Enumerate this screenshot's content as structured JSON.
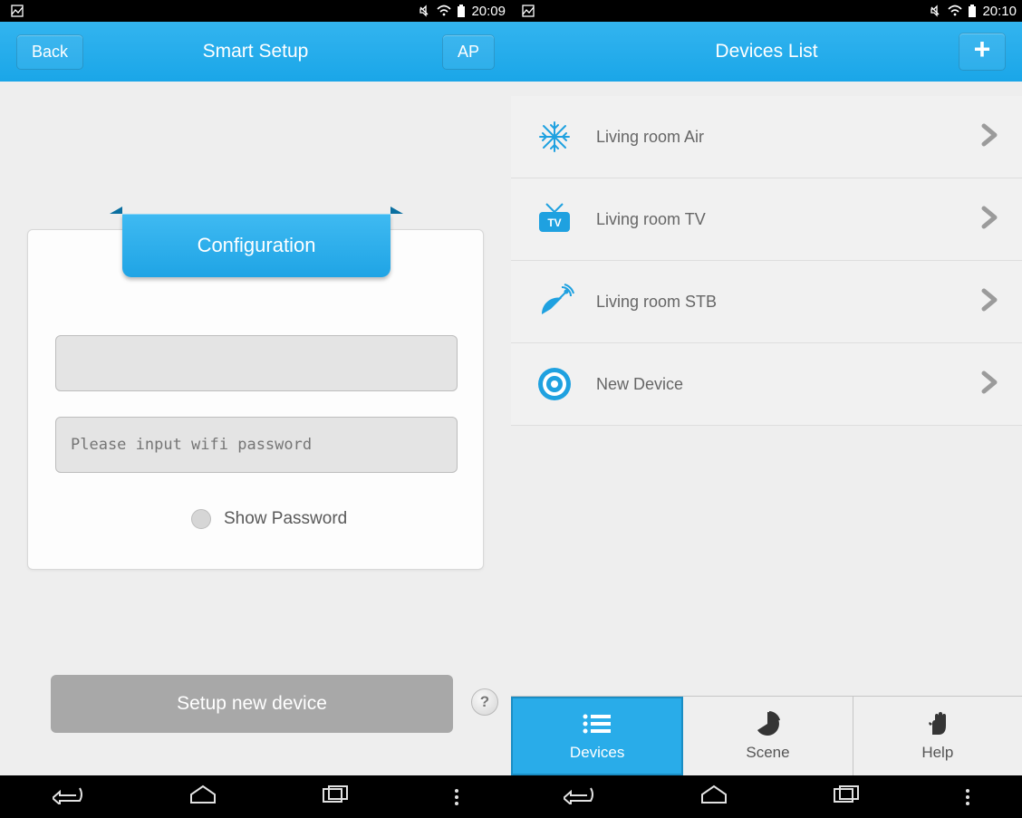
{
  "left": {
    "status": {
      "time": "20:09"
    },
    "header": {
      "back_label": "Back",
      "title": "Smart Setup",
      "ap_label": "AP"
    },
    "config": {
      "title": "Configuration",
      "ssid_value": "",
      "password_value": "",
      "password_placeholder": "Please input wifi password",
      "show_password_label": "Show Password"
    },
    "setup_button": "Setup new device",
    "help_symbol": "?"
  },
  "right": {
    "status": {
      "time": "20:10"
    },
    "header": {
      "title": "Devices List",
      "plus_label": "+"
    },
    "devices": [
      {
        "icon": "snowflake",
        "label": "Living room Air"
      },
      {
        "icon": "tv",
        "label": "Living room TV"
      },
      {
        "icon": "satellite",
        "label": "Living room STB"
      },
      {
        "icon": "target",
        "label": "New Device"
      }
    ],
    "tabs": [
      {
        "icon": "list",
        "label": "Devices",
        "active": true
      },
      {
        "icon": "pie",
        "label": "Scene",
        "active": false
      },
      {
        "icon": "hand",
        "label": "Help",
        "active": false
      }
    ]
  }
}
